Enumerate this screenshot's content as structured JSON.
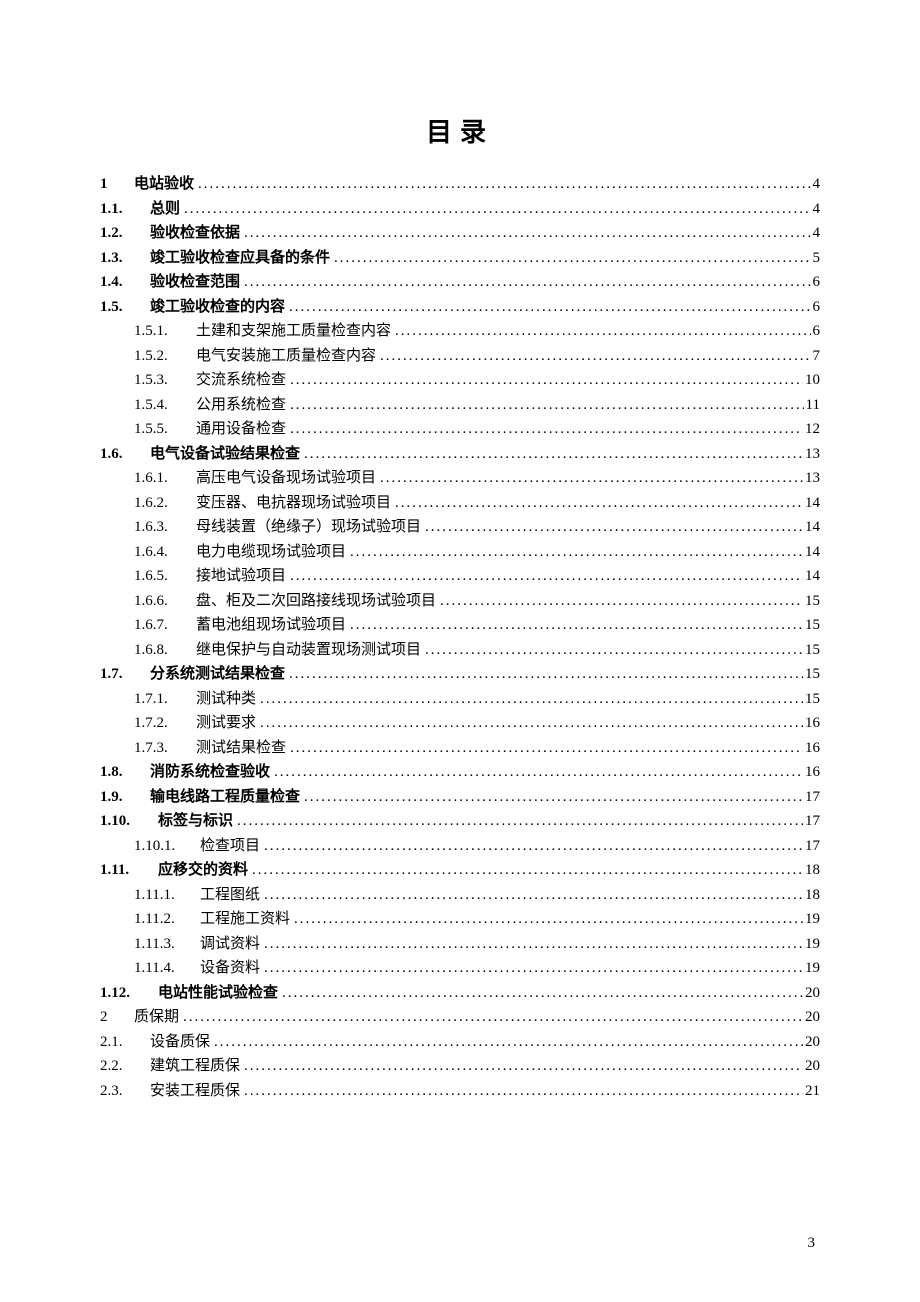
{
  "title": "目录",
  "page_number": "3",
  "entries": [
    {
      "level": "lvl1",
      "bold": true,
      "num": "1",
      "text": "电站验收",
      "page": "4"
    },
    {
      "level": "lvl2",
      "bold": true,
      "num": "1.1.",
      "text": "总则",
      "page": "4"
    },
    {
      "level": "lvl2",
      "bold": true,
      "num": "1.2.",
      "text": "验收检查依据",
      "page": "4"
    },
    {
      "level": "lvl2",
      "bold": true,
      "num": "1.3.",
      "text": "竣工验收检查应具备的条件",
      "page": "5"
    },
    {
      "level": "lvl2",
      "bold": true,
      "num": "1.4.",
      "text": "验收检查范围",
      "page": "6"
    },
    {
      "level": "lvl2",
      "bold": true,
      "num": "1.5.",
      "text": "竣工验收检查的内容",
      "page": "6"
    },
    {
      "level": "lvl3",
      "bold": false,
      "num": "1.5.1.",
      "text": "土建和支架施工质量检查内容",
      "page": "6"
    },
    {
      "level": "lvl3",
      "bold": false,
      "num": "1.5.2.",
      "text": "电气安装施工质量检查内容",
      "page": "7"
    },
    {
      "level": "lvl3",
      "bold": false,
      "num": "1.5.3.",
      "text": "交流系统检查",
      "page": "10"
    },
    {
      "level": "lvl3",
      "bold": false,
      "num": "1.5.4.",
      "text": "公用系统检查",
      "page": "11"
    },
    {
      "level": "lvl3",
      "bold": false,
      "num": "1.5.5.",
      "text": "通用设备检查",
      "page": "12"
    },
    {
      "level": "lvl2",
      "bold": true,
      "num": "1.6.",
      "text": "电气设备试验结果检查",
      "page": "13"
    },
    {
      "level": "lvl3",
      "bold": false,
      "num": "1.6.1.",
      "text": "高压电气设备现场试验项目",
      "page": "13"
    },
    {
      "level": "lvl3",
      "bold": false,
      "num": "1.6.2.",
      "text": "变压器、电抗器现场试验项目",
      "page": "14"
    },
    {
      "level": "lvl3",
      "bold": false,
      "num": "1.6.3.",
      "text": "母线装置（绝缘子）现场试验项目",
      "page": "14"
    },
    {
      "level": "lvl3",
      "bold": false,
      "num": "1.6.4.",
      "text": "电力电缆现场试验项目",
      "page": "14"
    },
    {
      "level": "lvl3",
      "bold": false,
      "num": "1.6.5.",
      "text": "接地试验项目",
      "page": "14"
    },
    {
      "level": "lvl3",
      "bold": false,
      "num": "1.6.6.",
      "text": "盘、柜及二次回路接线现场试验项目",
      "page": "15"
    },
    {
      "level": "lvl3",
      "bold": false,
      "num": "1.6.7.",
      "text": "蓄电池组现场试验项目",
      "page": "15"
    },
    {
      "level": "lvl3",
      "bold": false,
      "num": "1.6.8.",
      "text": "继电保护与自动装置现场测试项目",
      "page": "15"
    },
    {
      "level": "lvl2",
      "bold": true,
      "num": "1.7.",
      "text": "分系统测试结果检查",
      "page": "15"
    },
    {
      "level": "lvl3",
      "bold": false,
      "num": "1.7.1.",
      "text": "测试种类",
      "page": "15"
    },
    {
      "level": "lvl3",
      "bold": false,
      "num": "1.7.2.",
      "text": "测试要求",
      "page": "16"
    },
    {
      "level": "lvl3",
      "bold": false,
      "num": "1.7.3.",
      "text": "测试结果检查",
      "page": "16"
    },
    {
      "level": "lvl2",
      "bold": true,
      "num": "1.8.",
      "text": "消防系统检查验收",
      "page": "16"
    },
    {
      "level": "lvl2",
      "bold": true,
      "num": "1.9.",
      "text": "输电线路工程质量检查",
      "page": "17"
    },
    {
      "level": "lvl2b",
      "bold": true,
      "num": "1.10.",
      "text": "标签与标识",
      "page": "17"
    },
    {
      "level": "lvl3b",
      "bold": false,
      "num": "1.10.1.",
      "text": "检查项目",
      "page": "17"
    },
    {
      "level": "lvl2b",
      "bold": true,
      "num": "1.11.",
      "text": "应移交的资料",
      "page": "18"
    },
    {
      "level": "lvl3b",
      "bold": false,
      "num": "1.11.1.",
      "text": "工程图纸",
      "page": "18"
    },
    {
      "level": "lvl3b",
      "bold": false,
      "num": "1.11.2.",
      "text": "工程施工资料",
      "page": "19"
    },
    {
      "level": "lvl3b",
      "bold": false,
      "num": "1.11.3.",
      "text": "调试资料",
      "page": "19"
    },
    {
      "level": "lvl3b",
      "bold": false,
      "num": "1.11.4.",
      "text": "设备资料",
      "page": "19"
    },
    {
      "level": "lvl2b",
      "bold": true,
      "num": "1.12.",
      "text": "电站性能试验检查",
      "page": "20"
    },
    {
      "level": "lvl1",
      "bold": false,
      "num": "2",
      "text": "质保期",
      "page": "20"
    },
    {
      "level": "lvl2",
      "bold": false,
      "num": "2.1.",
      "text": "设备质保",
      "page": "20"
    },
    {
      "level": "lvl2",
      "bold": false,
      "num": "2.2.",
      "text": "建筑工程质保",
      "page": "20"
    },
    {
      "level": "lvl2",
      "bold": false,
      "num": "2.3.",
      "text": "安装工程质保",
      "page": "21"
    }
  ]
}
